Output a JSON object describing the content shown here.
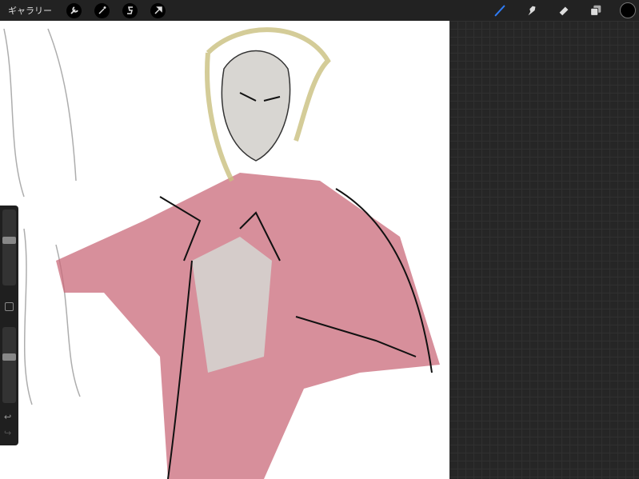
{
  "topbar": {
    "gallery_label": "ギャラリー",
    "left_tools": [
      "actions-wrench-icon",
      "adjustments-magic-wand-icon",
      "selection-s-icon",
      "transform-arrow-icon"
    ],
    "right_tools": [
      "brush-icon",
      "smudge-icon",
      "eraser-icon",
      "layers-icon"
    ],
    "active_tool": "brush",
    "accent_color": "#2f7cf6",
    "current_color": "#000000"
  },
  "sidebar": {
    "brush_size": 0.6,
    "opacity": 0.62,
    "undo_icon": "↩",
    "redo_icon": "↪"
  }
}
